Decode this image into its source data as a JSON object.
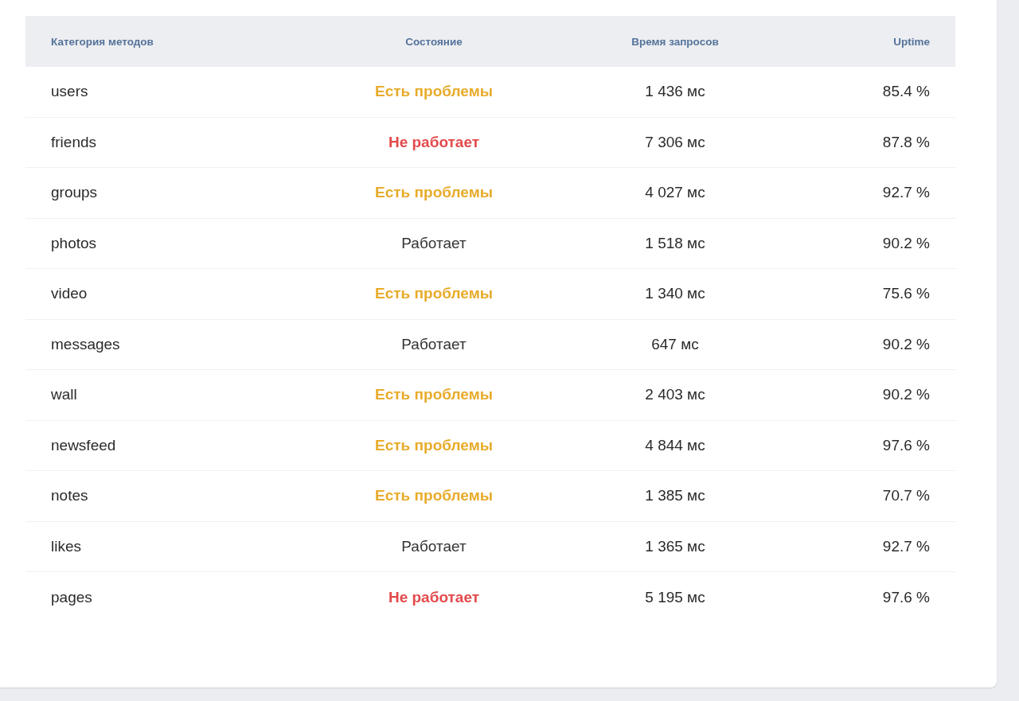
{
  "table": {
    "columns": [
      "Категория методов",
      "Состояние",
      "Время запросов",
      "Uptime"
    ],
    "rows": [
      {
        "category": "users",
        "status": {
          "text": "Есть проблемы",
          "kind": "problems"
        },
        "time": "1 436 мс",
        "uptime": "85.4 %"
      },
      {
        "category": "friends",
        "status": {
          "text": "Не работает",
          "kind": "down"
        },
        "time": "7 306 мс",
        "uptime": "87.8 %"
      },
      {
        "category": "groups",
        "status": {
          "text": "Есть проблемы",
          "kind": "problems"
        },
        "time": "4 027 мс",
        "uptime": "92.7 %"
      },
      {
        "category": "photos",
        "status": {
          "text": "Работает",
          "kind": "ok"
        },
        "time": "1 518 мс",
        "uptime": "90.2 %"
      },
      {
        "category": "video",
        "status": {
          "text": "Есть проблемы",
          "kind": "problems"
        },
        "time": "1 340 мс",
        "uptime": "75.6 %"
      },
      {
        "category": "messages",
        "status": {
          "text": "Работает",
          "kind": "ok"
        },
        "time": "647 мс",
        "uptime": "90.2 %"
      },
      {
        "category": "wall",
        "status": {
          "text": "Есть проблемы",
          "kind": "problems"
        },
        "time": "2 403 мс",
        "uptime": "90.2 %"
      },
      {
        "category": "newsfeed",
        "status": {
          "text": "Есть проблемы",
          "kind": "problems"
        },
        "time": "4 844 мс",
        "uptime": "97.6 %"
      },
      {
        "category": "notes",
        "status": {
          "text": "Есть проблемы",
          "kind": "problems"
        },
        "time": "1 385 мс",
        "uptime": "70.7 %"
      },
      {
        "category": "likes",
        "status": {
          "text": "Работает",
          "kind": "ok"
        },
        "time": "1 365 мс",
        "uptime": "92.7 %"
      },
      {
        "category": "pages",
        "status": {
          "text": "Не работает",
          "kind": "down"
        },
        "time": "5 195 мс",
        "uptime": "97.6 %"
      }
    ]
  }
}
